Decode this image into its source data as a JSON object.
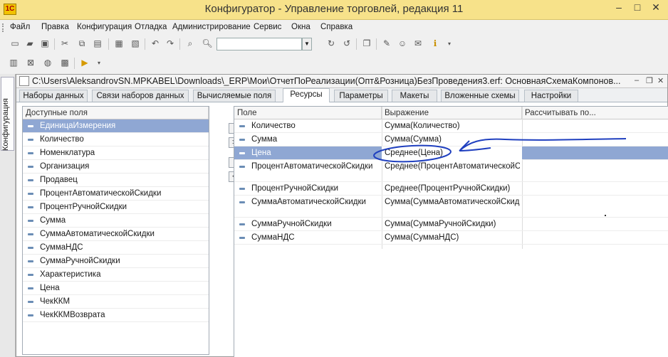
{
  "window": {
    "title": "Конфигуратор - Управление торговлей, редакция 11",
    "app_icon_text": "1С"
  },
  "menu": [
    "Файл",
    "Правка",
    "Конфигурация",
    "Отладка",
    "Администрирование",
    "Сервис",
    "Окна",
    "Справка"
  ],
  "search": {
    "value": ""
  },
  "side_tab": {
    "label": "Конфигурация"
  },
  "document": {
    "title": "C:\\Users\\AleksandrovSN.MPKABEL\\Downloads\\_ERP\\Мои\\ОтчетПоРеализации(Опт&Розница)БезПроведения3.erf: ОсновнаяСхемаКомпонов...",
    "tabs": [
      "Наборы данных",
      "Связи наборов данных",
      "Вычисляемые поля",
      "Ресурсы",
      "Параметры",
      "Макеты",
      "Вложенные схемы",
      "Настройки"
    ],
    "active_tab": "Ресурсы"
  },
  "available_fields": {
    "header": "Доступные поля",
    "items": [
      "ЕдиницаИзмерения",
      "Количество",
      "Номенклатура",
      "Организация",
      "Продавец",
      "ПроцентАвтоматическойСкидки",
      "ПроцентРучнойСкидки",
      "Сумма",
      "СуммаАвтоматическойСкидки",
      "СуммаНДС",
      "СуммаРучнойСкидки",
      "Характеристика",
      "Цена",
      "ЧекККМ",
      "ЧекККМВозврата"
    ],
    "selected_index": 0
  },
  "move_buttons": [
    ">",
    ">>",
    "<",
    "<<"
  ],
  "resources": {
    "headers": [
      "Поле",
      "Выражение",
      "Рассчитывать по..."
    ],
    "rows": [
      {
        "field": "Количество",
        "expr": "Сумма(Количество)",
        "calc": ""
      },
      {
        "field": "Сумма",
        "expr": "Сумма(Сумма)",
        "calc": ""
      },
      {
        "field": "Цена",
        "expr": "Среднее(Цена)",
        "calc": ""
      },
      {
        "field": "ПроцентАвтоматическойСкидки",
        "expr": "Среднее(ПроцентАвтоматическойСк",
        "calc": ""
      },
      {
        "field": "ПроцентРучнойСкидки",
        "expr": "Среднее(ПроцентРучнойСкидки)",
        "calc": ""
      },
      {
        "field": "СуммаАвтоматическойСкидки",
        "expr": "Сумма(СуммаАвтоматическойСкидк",
        "calc": ""
      },
      {
        "field": "СуммаРучнойСкидки",
        "expr": "Сумма(СуммаРучнойСкидки)",
        "calc": ""
      },
      {
        "field": "СуммаНДС",
        "expr": "Сумма(СуммаНДС)",
        "calc": ""
      }
    ],
    "selected_index": 2
  },
  "colors": {
    "title_bar": "#f7e28a",
    "selection": "#8fa7d3",
    "annotation": "#1f3fbf"
  }
}
